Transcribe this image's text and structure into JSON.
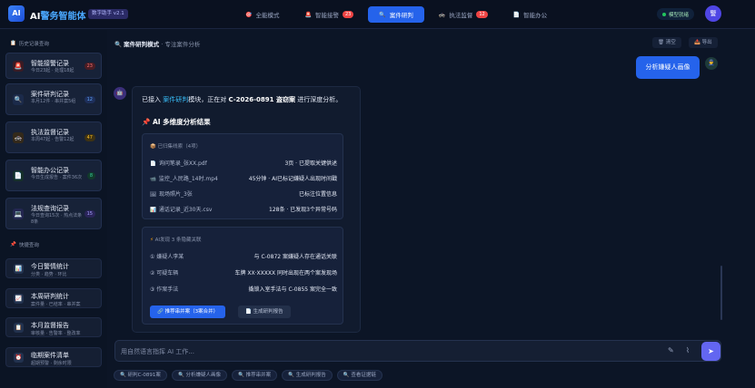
{
  "app": {
    "logo": "AI",
    "title_prefix": "AI",
    "title_main": "警务智能体",
    "version": "数字助手 v2.1"
  },
  "tabs": [
    {
      "label": "全能模式",
      "icon": "🎯",
      "badge": ""
    },
    {
      "label": "智能接警",
      "icon": "🚨",
      "badge": "23"
    },
    {
      "label": "案件研判",
      "icon": "🔍",
      "badge": ""
    },
    {
      "label": "执法监督",
      "icon": "🚓",
      "badge": "12"
    },
    {
      "label": "智能办公",
      "icon": "📄",
      "badge": ""
    }
  ],
  "header": {
    "status": "模型就绪",
    "avatar": "警"
  },
  "sidebar": {
    "history_title": "历史记录查询",
    "history": [
      {
        "icon": "🚨",
        "title": "智能接警记录",
        "sub": "今日23起 · 处理18起",
        "count": "23",
        "count_bg": "#4a1d24",
        "count_fg": "#f87171"
      },
      {
        "icon": "🔍",
        "title": "案件研判记录",
        "sub": "本月12件 · 串并案5组",
        "count": "12",
        "count_bg": "#1e2f5a",
        "count_fg": "#60a5fa"
      },
      {
        "icon": "🚓",
        "title": "执法监督记录",
        "sub": "本周47起 · 告警12起",
        "count": "47",
        "count_bg": "#3d3214",
        "count_fg": "#fbbf24"
      },
      {
        "icon": "📄",
        "title": "智能办公记录",
        "sub": "今日生成报告 · 案件36次",
        "count": "8",
        "count_bg": "#123a2c",
        "count_fg": "#34d399"
      },
      {
        "icon": "💻",
        "title": "法规查询记录",
        "sub": "今日查询15次 · 热点法条8条",
        "count": "15",
        "count_bg": "#2a2459",
        "count_fg": "#a5a2ff"
      }
    ],
    "quick_title": "快捷查询",
    "quick": [
      {
        "icon": "📊",
        "title": "今日警情统计",
        "sub": "分类 · 趋势 · 环比"
      },
      {
        "icon": "📈",
        "title": "本周研判统计",
        "sub": "案件量 · 已结率 · 串并案"
      },
      {
        "icon": "📋",
        "title": "本月监督报告",
        "sub": "审核量 · 告警率 · 整改率"
      },
      {
        "icon": "⏰",
        "title": "临期案件清单",
        "sub": "超期预警 · 剩余时限"
      }
    ]
  },
  "main": {
    "mode_title": "案件研判模式",
    "mode_sub": "· 专注案件分析",
    "clear_label": "清空",
    "export_label": "导出",
    "user_message": "分析嫌疑人画像",
    "bot": {
      "intro_pre": "已接入",
      "intro_module": "案件研判",
      "intro_mid": "模块，正在对",
      "intro_case": "C-2026-0891 盗窃案",
      "intro_post": "进行深度分析。",
      "result_title": "AI 多维度分析结果",
      "files_title": "已归集线索（4项）",
      "files": [
        {
          "icon": "📄",
          "name": "询问笔录_张XX.pdf",
          "stat": "3页 · 已提取关键供述"
        },
        {
          "icon": "📹",
          "name": "监控_人民路_14时.mp4",
          "stat": "45分钟 · AI已标记嫌疑人出现时间戳"
        },
        {
          "icon": "🖼",
          "name": "现场照片_3张",
          "stat": "已标注位置信息"
        },
        {
          "icon": "📊",
          "name": "通话记录_近30天.csv",
          "stat": "128条 · 已发现3个异常号码"
        }
      ],
      "link_title": "AI发现 3 条隐藏关联",
      "links": [
        {
          "name": "① 嫌疑人李某",
          "desc": "与 C-0872 案嫌疑人存在通话关联"
        },
        {
          "name": "② 可疑车辆",
          "desc": "车牌 XX·XXXXX 同时出现在两个案发现场"
        },
        {
          "name": "③ 作案手法",
          "desc": "撬锁入室手法与 C-0855 案完全一致"
        }
      ],
      "primary_action": "推荐串并案（3案合并）",
      "secondary_action": "生成研判报告"
    },
    "input_placeholder": "用自然语言指挥 AI 工作...",
    "quick_chips": [
      "研判C-0891案",
      "分析嫌疑人画像",
      "推荐串并案",
      "生成研判报告",
      "查看证据链"
    ]
  }
}
